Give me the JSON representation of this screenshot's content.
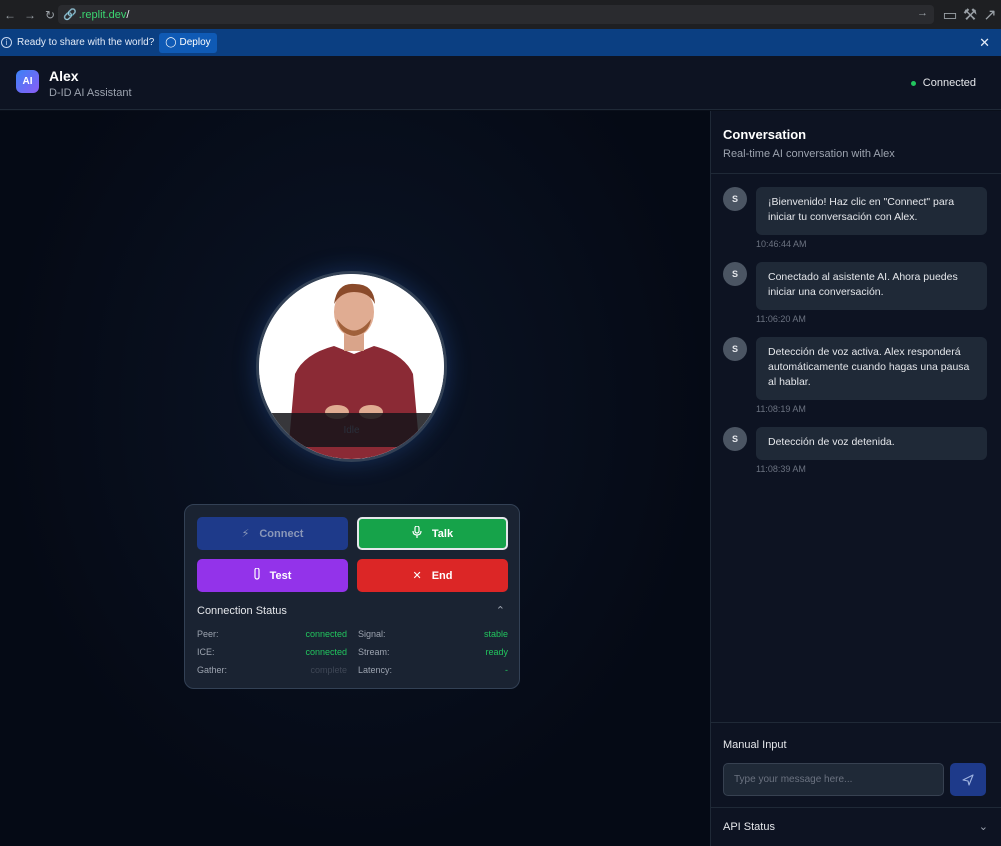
{
  "browser": {
    "url_host": ".replit.dev",
    "url_path": "/"
  },
  "banner": {
    "text": "Ready to share with the world?",
    "deploy_label": "Deploy"
  },
  "header": {
    "avatar_initials": "AI",
    "name": "Alex",
    "subtitle": "D-ID AI Assistant",
    "status": "Connected"
  },
  "stage": {
    "avatar_state": "Idle"
  },
  "controls": {
    "connect": "Connect",
    "talk": "Talk",
    "test": "Test",
    "end": "End"
  },
  "connection_status": {
    "title": "Connection Status",
    "rows": [
      {
        "key": "Peer:",
        "value": "connected"
      },
      {
        "key": "Signal:",
        "value": "stable"
      },
      {
        "key": "ICE:",
        "value": "connected"
      },
      {
        "key": "Stream:",
        "value": "ready"
      },
      {
        "key": "Gather:",
        "value": "complete"
      },
      {
        "key": "Latency:",
        "value": "-"
      }
    ]
  },
  "conversation": {
    "title": "Conversation",
    "subtitle": "Real-time AI conversation with Alex",
    "messages": [
      {
        "avatar": "S",
        "text": "¡Bienvenido! Haz clic en \"Connect\" para iniciar tu conversación con Alex.",
        "time": "10:46:44 AM"
      },
      {
        "avatar": "S",
        "text": "Conectado al asistente AI. Ahora puedes iniciar una conversación.",
        "time": "11:06:20 AM"
      },
      {
        "avatar": "S",
        "text": "Detección de voz activa. Alex responderá automáticamente cuando hagas una pausa al hablar.",
        "time": "11:08:19 AM"
      },
      {
        "avatar": "S",
        "text": "Detección de voz detenida.",
        "time": "11:08:39 AM"
      }
    ]
  },
  "manual_input": {
    "title": "Manual Input",
    "placeholder": "Type your message here..."
  },
  "api_status": {
    "title": "API Status"
  },
  "colors": {
    "connect": "#1e3a8a",
    "talk": "#16a34a",
    "test": "#9333ea",
    "end": "#dc2626",
    "status_green": "#22c55e"
  }
}
